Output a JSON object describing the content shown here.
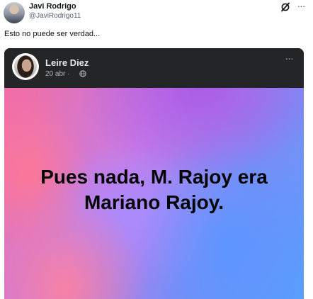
{
  "tweet": {
    "author_name": "Javi Rodrigo",
    "author_handle": "@JaviRodrigo11",
    "text": "Esto no puede ser verdad...",
    "grok_icon": "grok-icon",
    "more_icon": "more-icon",
    "more_label": "···"
  },
  "media": {
    "facebook_post": {
      "author_name": "Leire Diez",
      "date": "20 abr · ",
      "privacy_icon": "globe-icon",
      "more_label": "···",
      "text_line1": "Pues nada, M. Rajoy era",
      "text_line2": "Mariano Rajoy."
    }
  }
}
